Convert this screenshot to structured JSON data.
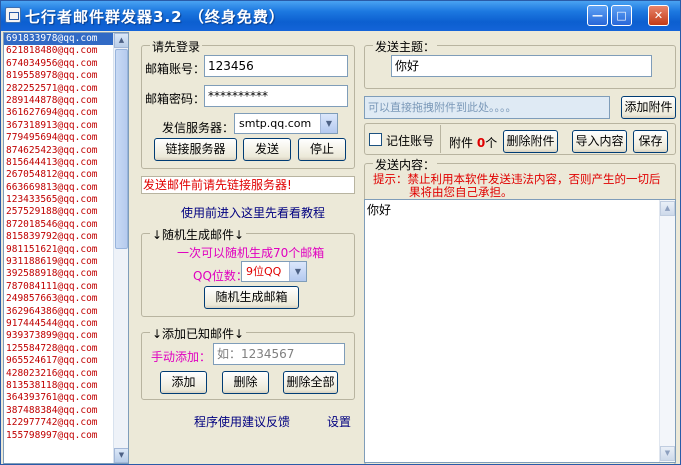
{
  "window": {
    "title": "七行者邮件群发器",
    "version": "3.2",
    "subtitle": "（终身免费）",
    "controls": {
      "minimize": "—",
      "maximize": "□",
      "close": "✕"
    }
  },
  "email_list": [
    "691833978@qq.com",
    "621818480@qq.com",
    "674034956@qq.com",
    "819558978@qq.com",
    "282252571@qq.com",
    "289144878@qq.com",
    "361627694@qq.com",
    "367318913@qq.com",
    "779495694@qq.com",
    "874625423@qq.com",
    "815644413@qq.com",
    "267054812@qq.com",
    "663669813@qq.com",
    "123433565@qq.com",
    "257529188@qq.com",
    "872018546@qq.com",
    "815839792@qq.com",
    "981151621@qq.com",
    "931188619@qq.com",
    "392588918@qq.com",
    "787084111@qq.com",
    "249857663@qq.com",
    "362964386@qq.com",
    "917444544@qq.com",
    "939373899@qq.com",
    "125584728@qq.com",
    "965524617@qq.com",
    "428023216@qq.com",
    "813538118@qq.com",
    "364393761@qq.com",
    "387488384@qq.com",
    "122977742@qq.com",
    "155798997@qq.com"
  ],
  "login": {
    "legend": "请先登录",
    "account_label": "邮箱账号：",
    "account_value": "123456",
    "password_label": "邮箱密码：",
    "password_value": "**********",
    "server_label": "发信服务器：",
    "server_value": "smtp.qq.com",
    "connect_button": "链接服务器",
    "send_button": "发送",
    "stop_button": "停止"
  },
  "status_warning": "发送邮件前请先链接服务器!",
  "tutorial_link": "使用前进入这里先看看教程",
  "random_gen": {
    "legend": "↓随机生成邮件↓",
    "hint": "一次可以随机生成70个邮箱",
    "qq_digits_label": "QQ位数：",
    "qq_digits_value": "9位QQ",
    "generate_button": "随机生成邮箱"
  },
  "add_known": {
    "legend": "↓添加已知邮件↓",
    "manual_label": "手动添加：",
    "manual_placeholder": "如：1234567",
    "add_button": "添加",
    "delete_button": "删除",
    "delete_all_button": "删除全部"
  },
  "footer": {
    "feedback_link": "程序使用建议反馈",
    "settings_link": "设置"
  },
  "subject": {
    "legend": "发送主题：",
    "value": "你好"
  },
  "attachment": {
    "drop_hint": "可以直接拖拽附件到此处。。。。",
    "add_button": "添加附件",
    "remember_label": "记住账号",
    "count_prefix": "附件",
    "count": "0",
    "count_suffix": "个",
    "delete_button": "删除附件",
    "import_button": "导入内容",
    "save_button": "保存"
  },
  "content": {
    "legend": "发送内容：",
    "notice_line1": "提示：禁止利用本软件发送违法内容，否则产生的一切后",
    "notice_line2": "果将由您自己承担。",
    "body": "你好"
  },
  "colors": {
    "title_blue": "#0c5fd0",
    "warning_red": "#e00000",
    "email_red": "#c00000",
    "hint_magenta": "#e000c0",
    "link_navy": "#000080"
  }
}
